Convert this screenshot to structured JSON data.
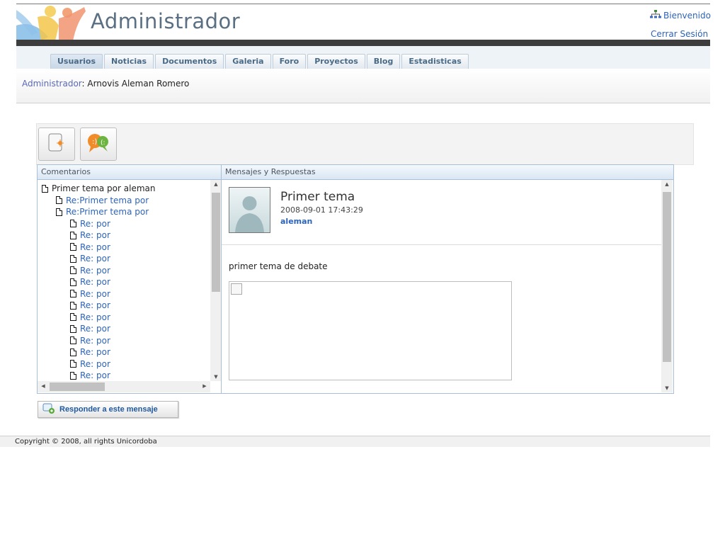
{
  "header": {
    "app_title": "Administrador",
    "welcome": "Bienvenido",
    "logout": "Cerrar Sesión",
    "logo_icon": "people-logo-icon",
    "sitemap_icon": "sitemap-icon"
  },
  "tabs": [
    {
      "label": "Usuarios",
      "active": true
    },
    {
      "label": "Noticias"
    },
    {
      "label": "Documentos"
    },
    {
      "label": "Galeria"
    },
    {
      "label": "Foro"
    },
    {
      "label": "Proyectos"
    },
    {
      "label": "Blog"
    },
    {
      "label": "Estadisticas"
    }
  ],
  "breadcrumb": {
    "role": "Administrador",
    "user": ": Arnovis Aleman Romero"
  },
  "toolbar": {
    "new_topic_icon": "new-topic-icon",
    "chat_icon": "chat-faces-icon"
  },
  "comments_panel": {
    "title": "Comentarios",
    "items": [
      {
        "label": "Primer tema por aleman",
        "level": 0
      },
      {
        "label": "Re:Primer tema por",
        "level": 1
      },
      {
        "label": "Re:Primer tema por",
        "level": 1
      },
      {
        "label": "Re: por",
        "level": 2
      },
      {
        "label": "Re: por",
        "level": 2
      },
      {
        "label": "Re: por",
        "level": 2
      },
      {
        "label": "Re: por",
        "level": 2
      },
      {
        "label": "Re: por",
        "level": 2
      },
      {
        "label": "Re: por",
        "level": 2
      },
      {
        "label": "Re: por",
        "level": 2
      },
      {
        "label": "Re: por",
        "level": 2
      },
      {
        "label": "Re: por",
        "level": 2
      },
      {
        "label": "Re: por",
        "level": 2
      },
      {
        "label": "Re: por",
        "level": 2
      },
      {
        "label": "Re: por",
        "level": 2
      },
      {
        "label": "Re: por",
        "level": 2
      },
      {
        "label": "Re: por",
        "level": 2
      }
    ]
  },
  "messages_panel": {
    "title": "Mensajes y Respuestas",
    "message": {
      "title": "Primer tema",
      "date": "2008-09-01 17:43:29",
      "user": "aleman",
      "body": "primer tema de debate"
    }
  },
  "reply_button": {
    "label": "Responder a este mensaje"
  },
  "footer": {
    "copyright": "Copyright © 2008, all rights Unicordoba"
  }
}
